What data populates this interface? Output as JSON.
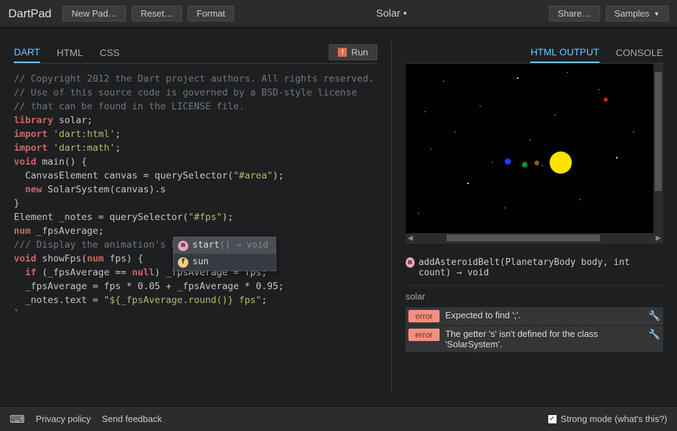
{
  "header": {
    "app_title": "DartPad",
    "new_pad": "New Pad…",
    "reset": "Reset…",
    "format": "Format",
    "file_title": "Solar •",
    "share": "Share…",
    "samples": "Samples"
  },
  "left_tabs": {
    "dart": "DART",
    "html": "HTML",
    "css": "CSS",
    "run": "Run"
  },
  "code": {
    "l1": "// Copyright 2012 the Dart project authors. All rights reserved.",
    "l2": "// Use of this source code is governed by a BSD-style license",
    "l3": "// that can be found in the LICENSE file.",
    "l4": "",
    "l5a": "library",
    "l5b": " solar;",
    "l6": "",
    "l7a": "import",
    "l7b": " 'dart:html'",
    "l7c": ";",
    "l8a": "import",
    "l8b": " 'dart:math'",
    "l8c": ";",
    "l9": "",
    "l10a": "void",
    "l10b": " main() {",
    "l11a": "  CanvasElement canvas = querySelector(",
    "l11b": "\"#area\"",
    "l11c": ");",
    "l12a": "  ",
    "l12b": "new",
    "l12c": " SolarSystem(canvas).s",
    "l13": "}",
    "l14": "",
    "l15a": "Element _notes = querySelector(",
    "l15b": "\"#fps\"",
    "l15c": ");",
    "l16a": "num",
    "l16b": " _fpsAverage;",
    "l17": "",
    "l18": "/// Display the animation's FPS in a div.",
    "l19a": "void",
    "l19b": " showFps(",
    "l19c": "num",
    "l19d": " fps) {",
    "l20a": "  ",
    "l20b": "if",
    "l20c": " (_fpsAverage == ",
    "l20d": "null",
    "l20e": ") _fpsAverage = fps;",
    "l21": "  _fpsAverage = fps * 0.05 + _fpsAverage * 0.95;",
    "l22a": "  _notes.text = ",
    "l22b": "\"${_fpsAverage.round()} fps\"",
    "l22c": ";",
    "l23": "`"
  },
  "autocomplete": {
    "item1_name": "start",
    "item1_sig": "() → void",
    "item2_name": "sun"
  },
  "right_tabs": {
    "html_output": "HTML OUTPUT",
    "console": "CONSOLE"
  },
  "signature": {
    "text": "addAsteroidBelt(PlanetaryBody body, int count) → void"
  },
  "source": "solar",
  "errors": [
    {
      "label": "error",
      "text": "Expected to find ';'."
    },
    {
      "label": "error",
      "text": "The getter 's' isn't defined for the class 'SolarSystem'."
    }
  ],
  "footer": {
    "privacy": "Privacy policy",
    "feedback": "Send feedback",
    "strong_mode": "Strong mode (what's this?)"
  },
  "colors": {
    "sun": "#ffe300",
    "blue": "#2040ff",
    "green": "#109020",
    "brown": "#806030",
    "red": "#d02020"
  }
}
